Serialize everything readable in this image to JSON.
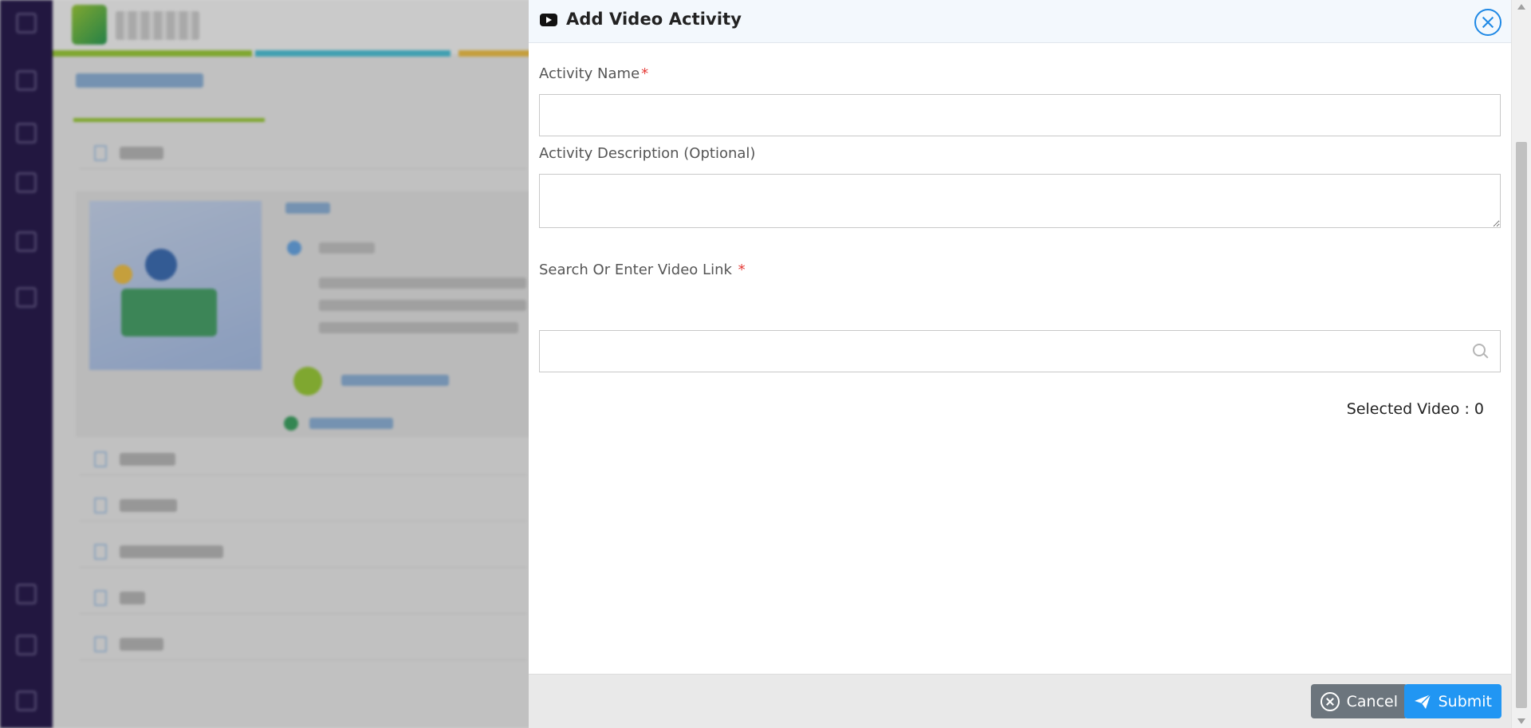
{
  "drawer": {
    "title": "Add Video Activity",
    "icon": "youtube-icon"
  },
  "form": {
    "activity_name": {
      "label": "Activity Name",
      "required_mark": "*",
      "value": "",
      "placeholder": ""
    },
    "activity_description": {
      "label": "Activity Description (Optional)",
      "value": "",
      "placeholder": ""
    },
    "video_link": {
      "label": "Search Or Enter Video Link",
      "required_mark": "*",
      "value": "",
      "placeholder": ""
    },
    "selected_video_text": "Selected Video : 0"
  },
  "footer": {
    "cancel_label": "Cancel",
    "submit_label": "Submit"
  },
  "colors": {
    "primary": "#2196f3",
    "cancel": "#6c757d",
    "required": "#e53935",
    "sidebar": "#2a1d4f"
  }
}
